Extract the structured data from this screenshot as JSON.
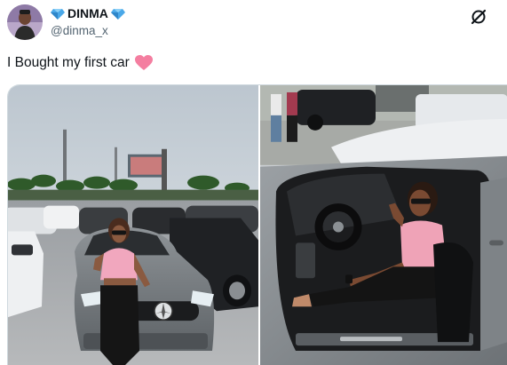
{
  "user": {
    "display_name": "DINMA",
    "handle": "@dinma_x",
    "badge_icon": "blue-diamond-icon"
  },
  "tweet": {
    "text": "I Bought my first car",
    "emoji_icon": "pink-heart-icon"
  },
  "toolbar": {
    "more_icon": "grok-icon"
  },
  "colors": {
    "text_primary": "#0f1419",
    "text_secondary": "#536471",
    "diamond_blue": "#4aa8e8",
    "heart_pink": "#f47ea0"
  }
}
